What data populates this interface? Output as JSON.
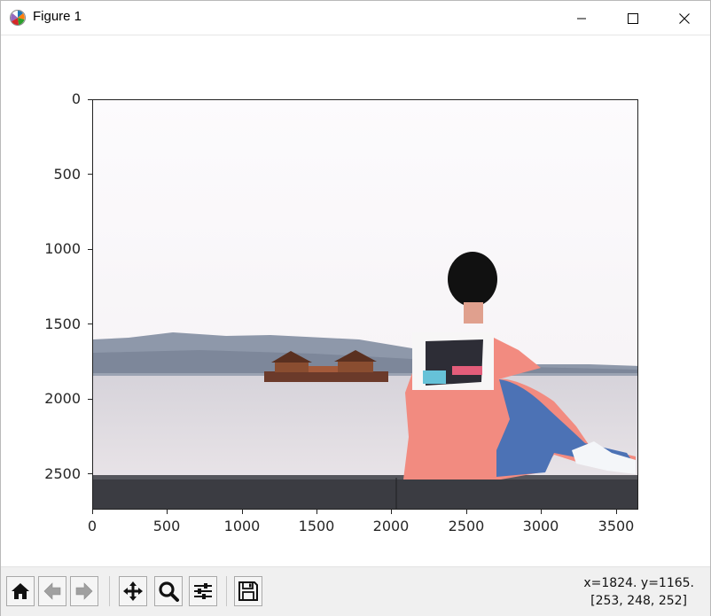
{
  "window": {
    "title": "Figure 1",
    "icon": "matplotlib-logo-icon",
    "controls": [
      "minimize-icon",
      "maximize-icon",
      "close-icon"
    ]
  },
  "axes": {
    "image_extent": {
      "width": 3648,
      "height": 2736
    },
    "y_ticks": [
      "0",
      "500",
      "1000",
      "1500",
      "2000",
      "2500"
    ],
    "x_ticks": [
      "0",
      "500",
      "1000",
      "1500",
      "2000",
      "2500",
      "3000",
      "3500"
    ],
    "image_description_colors": {
      "sky": "#fbf9fb",
      "hills": "#8c96a8",
      "water": "#ddd9de",
      "ledge": "#3e3e44",
      "shirt": "#f08c80",
      "jeans": "#4a6fb4"
    }
  },
  "toolbar": {
    "buttons": [
      {
        "name": "home-button",
        "icon": "home-icon"
      },
      {
        "name": "back-button",
        "icon": "arrow-left-icon"
      },
      {
        "name": "forward-button",
        "icon": "arrow-right-icon"
      },
      {
        "name": "pan-button",
        "icon": "move-icon"
      },
      {
        "name": "zoom-button",
        "icon": "magnifier-icon"
      },
      {
        "name": "configure-subplots-button",
        "icon": "sliders-icon"
      },
      {
        "name": "save-button",
        "icon": "floppy-disk-icon"
      }
    ],
    "coords_text": "x=1824. y=1165.",
    "pixel_value_text": "[253, 248, 252]"
  }
}
